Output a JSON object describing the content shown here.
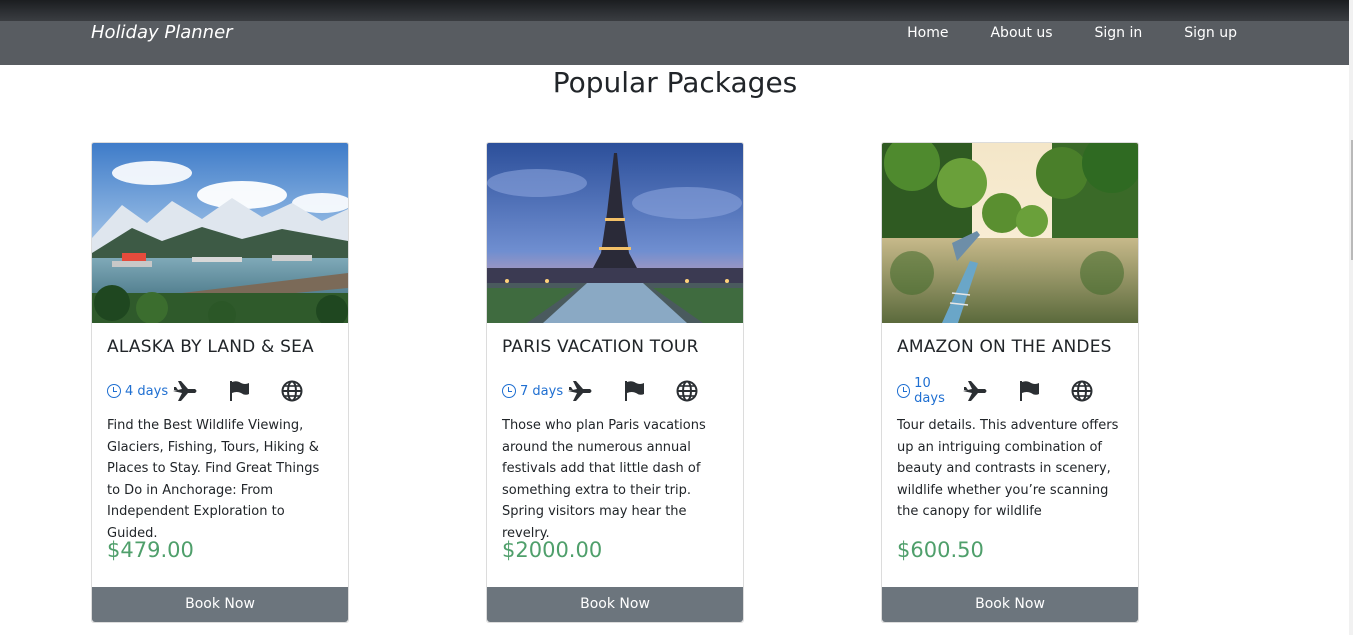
{
  "navbar": {
    "brand": "Holiday Planner",
    "links": [
      "Home",
      "About us",
      "Sign in",
      "Sign up"
    ]
  },
  "section": {
    "title": "Popular Packages"
  },
  "cards": [
    {
      "title": "ALASKA BY LAND & SEA",
      "duration": "4 days",
      "description": "Find the Best Wildlife Viewing, Glaciers, Fishing, Tours, Hiking & Places to Stay. Find Great Things to Do in Anchorage: From Independent Exploration to Guided.",
      "price": "$479.00",
      "button": "Book Now"
    },
    {
      "title": "PARIS VACATION TOUR",
      "duration": "7 days",
      "description": "Those who plan Paris vacations around the numerous annual festivals add that little dash of something extra to their trip. Spring visitors may hear the revelry.",
      "price": "$2000.00",
      "button": "Book Now"
    },
    {
      "title": "AMAZON ON THE ANDES",
      "duration": "10 days",
      "description": "Tour details. This adventure offers up an intriguing combination of beauty and contrasts in scenery, wildlife whether you’re scanning the canopy for wildlife",
      "price": "$600.50",
      "button": "Book Now"
    }
  ],
  "icons": [
    "clock-icon",
    "plane-icon",
    "flag-icon",
    "globe-icon"
  ],
  "colors": {
    "navbar": "#585c61",
    "accent": "#1f6fd1",
    "price": "#4f9f6b",
    "button": "#6c757d"
  }
}
